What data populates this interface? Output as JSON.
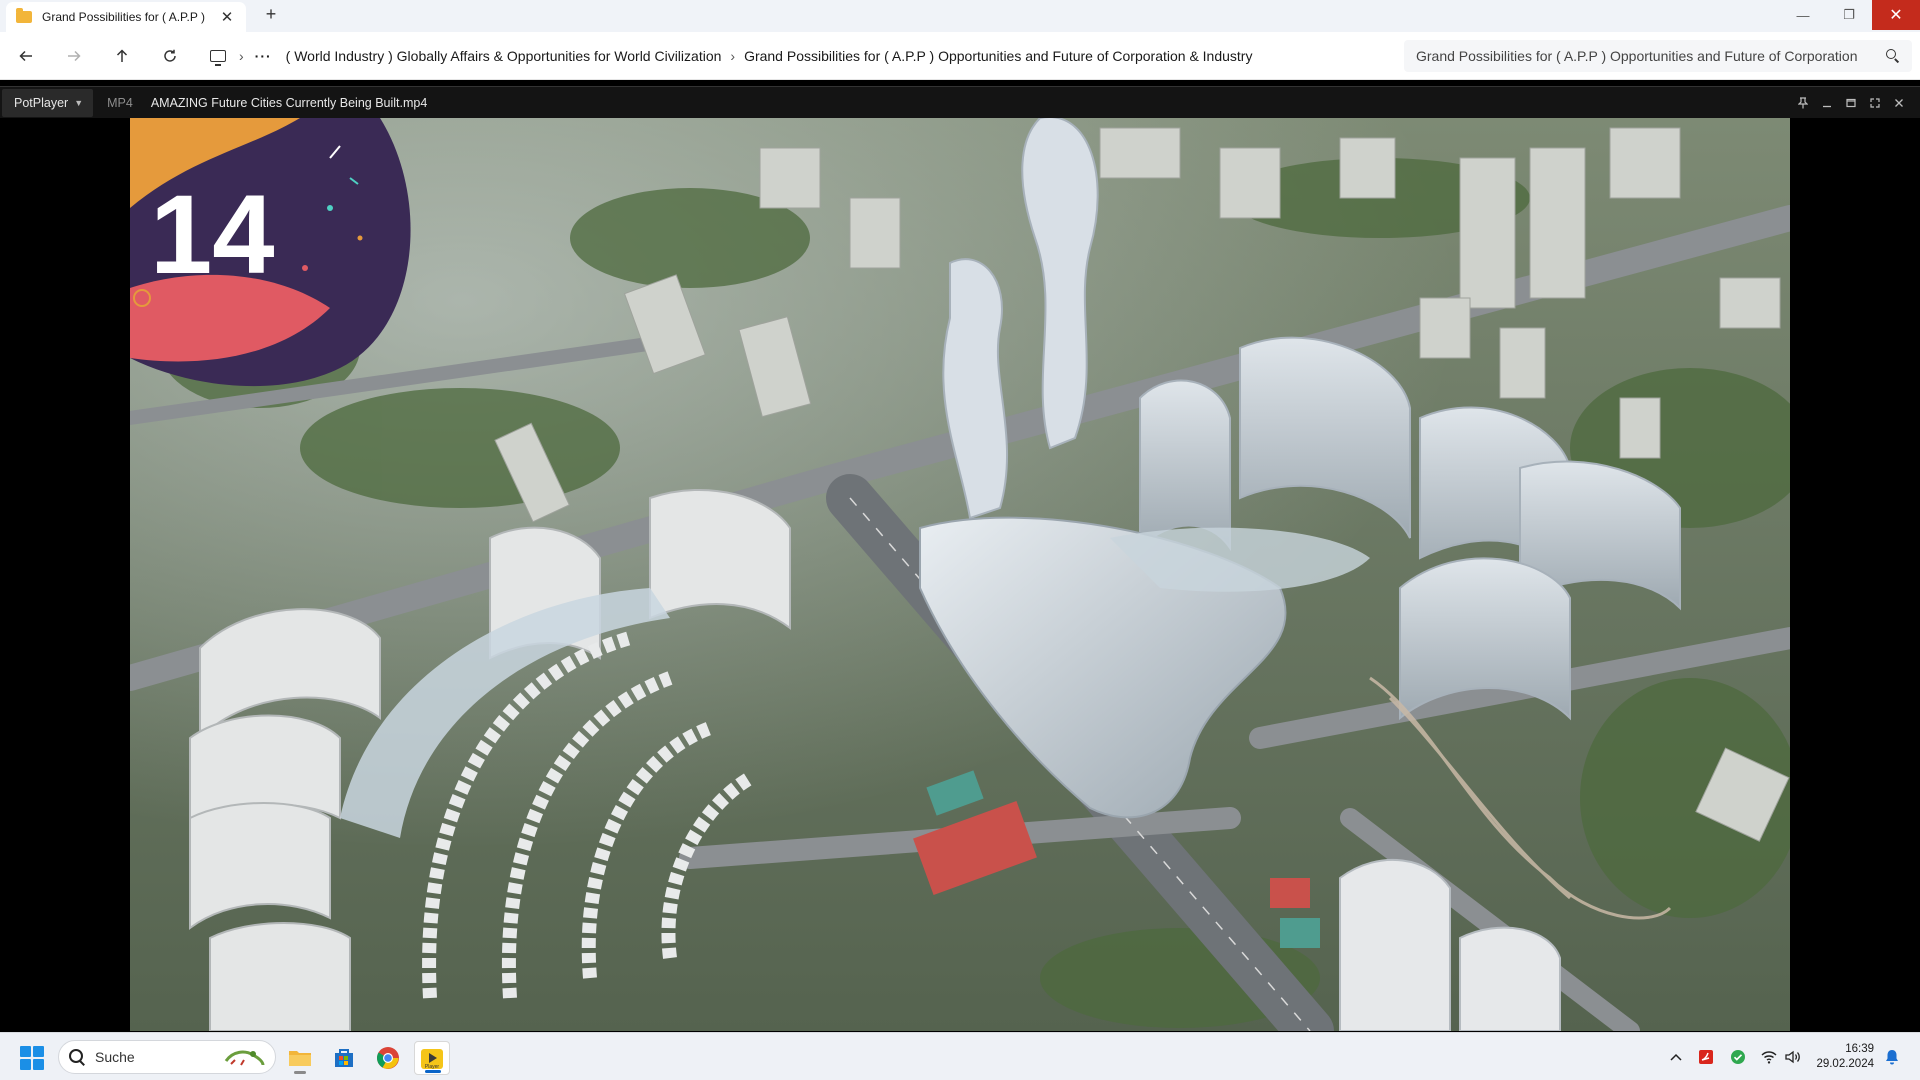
{
  "explorer": {
    "tab_title": "Grand Possibilities for ( A.P.P )",
    "tab_close_glyph": "✕",
    "new_tab_glyph": "+",
    "window_controls": {
      "minimize": "—",
      "maximize": "❐",
      "close": "✕"
    },
    "breadcrumbs": [
      "( World Industry ) Globally Affairs & Opportunities for World Civilization",
      "Grand Possibilities for ( A.P.P ) Opportunities and Future of Corporation & Industry"
    ],
    "more_glyph": "···",
    "search_text": "Grand Possibilities for ( A.P.P ) Opportunities and Future of Corporation"
  },
  "potplayer": {
    "menu_label": "PotPlayer",
    "format": "MP4",
    "filename": "AMAZING Future Cities Currently Being Built.mp4"
  },
  "video": {
    "overlay_number": "14"
  },
  "taskbar": {
    "search_label": "Suche",
    "time": "16:39",
    "date": "29.02.2024"
  },
  "colors": {
    "window_close": "#c42b1c",
    "start_blue": "#1b8fe6",
    "folder_yellow": "#f2b53a",
    "overlay_purple": "#3a2a55",
    "overlay_orange": "#e59a3c",
    "overlay_pink": "#e05a63",
    "overlay_teal": "#4fd0c3"
  }
}
